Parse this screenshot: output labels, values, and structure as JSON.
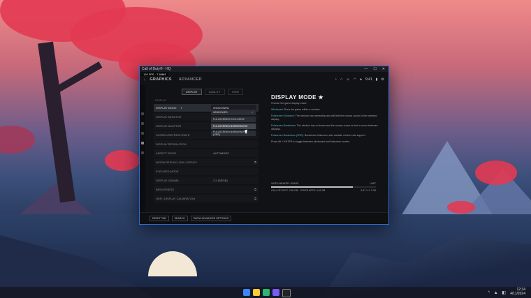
{
  "window": {
    "title": "Call of Duty® - HQ",
    "fps_overlay": "120 FPS · 7.65MS"
  },
  "appbar": {
    "tabs": [
      "GRAPHICS",
      "ADVANCED"
    ],
    "active_tab": 0,
    "icons": [
      "bell-icon",
      "headset-icon",
      "friends-icon",
      "wifi-icon",
      "user-icon",
      "mic-icon",
      "clock-icon"
    ],
    "clock": "9:41"
  },
  "subtabs": [
    {
      "label": "DISPLAY",
      "active": true
    },
    {
      "label": "QUALITY",
      "active": false
    },
    {
      "label": "VIEW",
      "active": false
    }
  ],
  "section_title": "DISPLAY",
  "settings": [
    {
      "label": "DISPLAY MODE",
      "value": "WINDOWED",
      "highlight": true,
      "has_chevron": true
    },
    {
      "label": "DISPLAY MONITOR",
      "value": "",
      "highlight": false
    },
    {
      "label": "DISPLAY ADAPTER",
      "value": "",
      "highlight": false
    },
    {
      "label": "SCREEN REFRESH RATE",
      "value": "",
      "highlight": false
    },
    {
      "label": "DISPLAY RESOLUTION",
      "value": "",
      "highlight": false
    },
    {
      "label": "ASPECT RATIO",
      "value": "AUTOMATIC",
      "highlight": false
    },
    {
      "label": "NVIDIA REFLEX LOW LATENCY",
      "value": "",
      "highlight": false,
      "external": true
    },
    {
      "label": "FOCUSED MODE",
      "value": "",
      "highlight": false
    },
    {
      "label": "DISPLAY GAMMA",
      "value": "2.2 (SRGB)",
      "highlight": false
    },
    {
      "label": "BRIGHTNESS",
      "value": "",
      "highlight": false,
      "external": true
    },
    {
      "label": "HDR / DISPLAY CALIBRATION",
      "value": "",
      "highlight": false,
      "external": true
    }
  ],
  "dropdown": [
    {
      "label": "WINDOWED",
      "selected": false,
      "checked": true
    },
    {
      "label": "FULLSCREEN EXCLUSIVE",
      "selected": false
    },
    {
      "label": "FULLSCREEN BORDERLESS",
      "selected": true
    },
    {
      "label": "FULLSCREEN BORDERLESS (VRR)",
      "selected": false
    }
  ],
  "detail": {
    "title": "DISPLAY MODE ★",
    "intro": "Choose the game display mode.",
    "items": [
      {
        "name": "Windowed:",
        "text": "Runs the game within a window."
      },
      {
        "name": "Fullscreen Exclusive:",
        "text": "The window has ownership and will limit the mouse cursor to the selected display."
      },
      {
        "name": "Fullscreen Borderless:",
        "text": "The window has no frame and the mouse cursor is free to move between displays."
      },
      {
        "name": "Fullscreen Borderless (VRR):",
        "text": "Borderless fullscreen with variable refresh rate support."
      }
    ],
    "note": "Press Alt + ENTER to toggle between windowed and fullscreen modes."
  },
  "usage": {
    "label": "VIDEO MEMORY USAGE",
    "right_label": "LIMIT",
    "fill_fraction": 0.78,
    "sub_left": "CALL OF DUTY: 2.84 GB · OTHER APPS: 0.62 GB",
    "sub_right": "9.87 / 11.7 GB"
  },
  "footer": {
    "buttons": [
      "RESET TAB",
      "SEARCH",
      "SHOW ADVANCED SETTINGS"
    ]
  },
  "taskbar": {
    "time": "12:34",
    "date": "4/11/2024",
    "tray": "^ ▲ ◧"
  }
}
